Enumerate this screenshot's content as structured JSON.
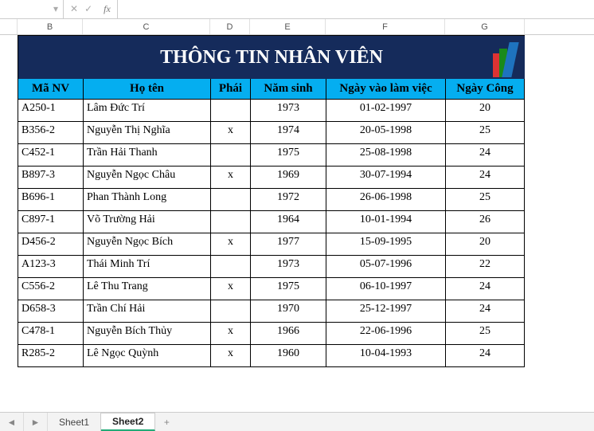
{
  "formula_bar": {
    "name_box": "",
    "fx_label": "fx"
  },
  "columns": [
    "",
    "B",
    "C",
    "D",
    "E",
    "F",
    "G"
  ],
  "banner_title": "THÔNG TIN NHÂN VIÊN",
  "headers": {
    "ma_nv": "Mã NV",
    "ho_ten": "Họ tên",
    "phai": "Phái",
    "nam_sinh": "Năm sinh",
    "ngay_vao": "Ngày vào làm việc",
    "ngay_cong": "Ngày Công"
  },
  "rows": [
    {
      "ma_nv": "A250-1",
      "ho_ten": "Lâm Đức Trí",
      "phai": "",
      "nam_sinh": "1973",
      "ngay_vao": "01-02-1997",
      "ngay_cong": "20"
    },
    {
      "ma_nv": "B356-2",
      "ho_ten": "Nguyễn Thị  Nghĩa",
      "phai": "x",
      "nam_sinh": "1974",
      "ngay_vao": "20-05-1998",
      "ngay_cong": "25"
    },
    {
      "ma_nv": "C452-1",
      "ho_ten": "Trần Hải Thanh",
      "phai": "",
      "nam_sinh": "1975",
      "ngay_vao": "25-08-1998",
      "ngay_cong": "24"
    },
    {
      "ma_nv": "B897-3",
      "ho_ten": "Nguyễn Ngọc Châu",
      "phai": "x",
      "nam_sinh": "1969",
      "ngay_vao": "30-07-1994",
      "ngay_cong": "24"
    },
    {
      "ma_nv": "B696-1",
      "ho_ten": "Phan Thành Long",
      "phai": "",
      "nam_sinh": "1972",
      "ngay_vao": "26-06-1998",
      "ngay_cong": "25"
    },
    {
      "ma_nv": "C897-1",
      "ho_ten": "Võ Trường Hải",
      "phai": "",
      "nam_sinh": "1964",
      "ngay_vao": "10-01-1994",
      "ngay_cong": "26"
    },
    {
      "ma_nv": "D456-2",
      "ho_ten": "Nguyễn Ngọc Bích",
      "phai": "x",
      "nam_sinh": "1977",
      "ngay_vao": "15-09-1995",
      "ngay_cong": "20"
    },
    {
      "ma_nv": "A123-3",
      "ho_ten": "Thái Minh Trí",
      "phai": "",
      "nam_sinh": "1973",
      "ngay_vao": "05-07-1996",
      "ngay_cong": "22"
    },
    {
      "ma_nv": "C556-2",
      "ho_ten": "Lê Thu Trang",
      "phai": "x",
      "nam_sinh": "1975",
      "ngay_vao": "06-10-1997",
      "ngay_cong": "24"
    },
    {
      "ma_nv": "D658-3",
      "ho_ten": "Trần Chí  Hải",
      "phai": "",
      "nam_sinh": "1970",
      "ngay_vao": "25-12-1997",
      "ngay_cong": "24"
    },
    {
      "ma_nv": "C478-1",
      "ho_ten": "Nguyễn Bích  Thủy",
      "phai": "x",
      "nam_sinh": "1966",
      "ngay_vao": "22-06-1996",
      "ngay_cong": "25"
    },
    {
      "ma_nv": "R285-2",
      "ho_ten": "Lê Ngọc Quỳnh",
      "phai": "x",
      "nam_sinh": "1960",
      "ngay_vao": "10-04-1993",
      "ngay_cong": "24"
    }
  ],
  "tabs": {
    "sheet1": "Sheet1",
    "sheet2": "Sheet2",
    "add": "+"
  },
  "icons": {
    "dropdown": "▾",
    "cancel": "✕",
    "confirm": "✓",
    "nav_left": "◄",
    "nav_right": "►"
  }
}
